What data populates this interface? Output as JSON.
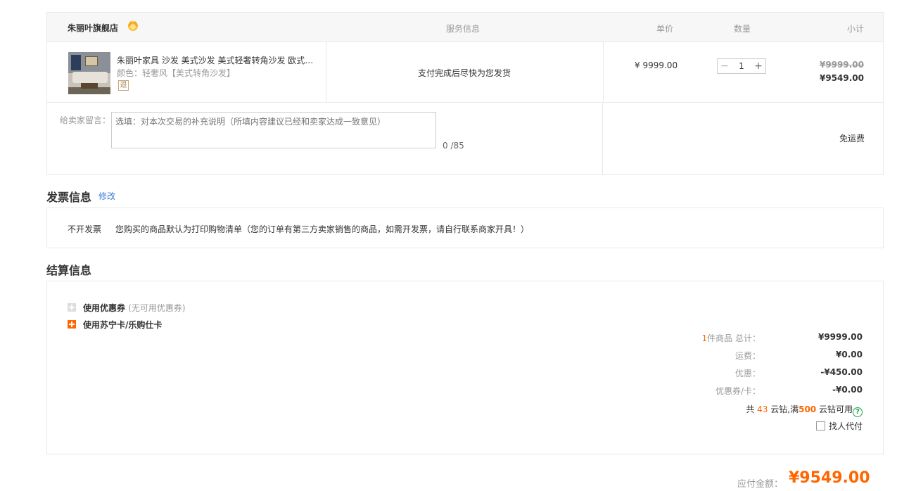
{
  "order": {
    "shop_name": "朱丽叶旗舰店",
    "headers": {
      "service": "服务信息",
      "price": "单价",
      "quantity": "数量",
      "subtotal": "小计"
    },
    "item": {
      "title": "朱丽叶家具 沙发 美式沙发 美式轻奢转角沙发 欧式…",
      "spec": "颜色：轻奢风【美式转角沙发】",
      "return_tag": "退",
      "service": "支付完成后尽快为您发货",
      "unit_price": "¥ 9999.00",
      "qty_minus": "−",
      "quantity": "1",
      "qty_plus": "+",
      "original_subtotal": "¥9999.00",
      "final_subtotal": "¥9549.00"
    },
    "message": {
      "label": "给卖家留言：",
      "placeholder": "选填：对本次交易的补充说明（所填内容建议已经和卖家达成一致意见）",
      "count": "0 /85"
    },
    "shipping": "免运费"
  },
  "invoice": {
    "title": "发票信息",
    "edit": "修改",
    "type": "不开发票",
    "description": "您购买的商品默认为打印购物清单（您的订单有第三方卖家销售的商品，如需开发票，请自行联系商家开具！）"
  },
  "settlement": {
    "title": "结算信息",
    "coupon_label": "使用优惠券",
    "coupon_note": "(无可用优惠券)",
    "card_label": "使用苏宁卡/乐购仕卡",
    "item_count": "1",
    "total_label": "件商品 总计：",
    "total_value": "¥9999.00",
    "freight_label": "运费：",
    "freight_value": "¥0.00",
    "discount_label": "优惠：",
    "discount_value": "-¥450.00",
    "coupon_card_label": "优惠券/卡：",
    "coupon_card_value": "-¥0.00",
    "coins_prefix": "共",
    "coins_count": "43",
    "coins_mid": "云钻,满",
    "coins_threshold": "500",
    "coins_suffix": "云钻可用",
    "help": "?",
    "pay_for_label": "找人代付"
  },
  "total": {
    "label": "应付金额：",
    "value": "¥9549.00"
  },
  "colors": {
    "accent": "#ff6600",
    "link": "#3a7bd5",
    "help": "#1ba84a"
  }
}
